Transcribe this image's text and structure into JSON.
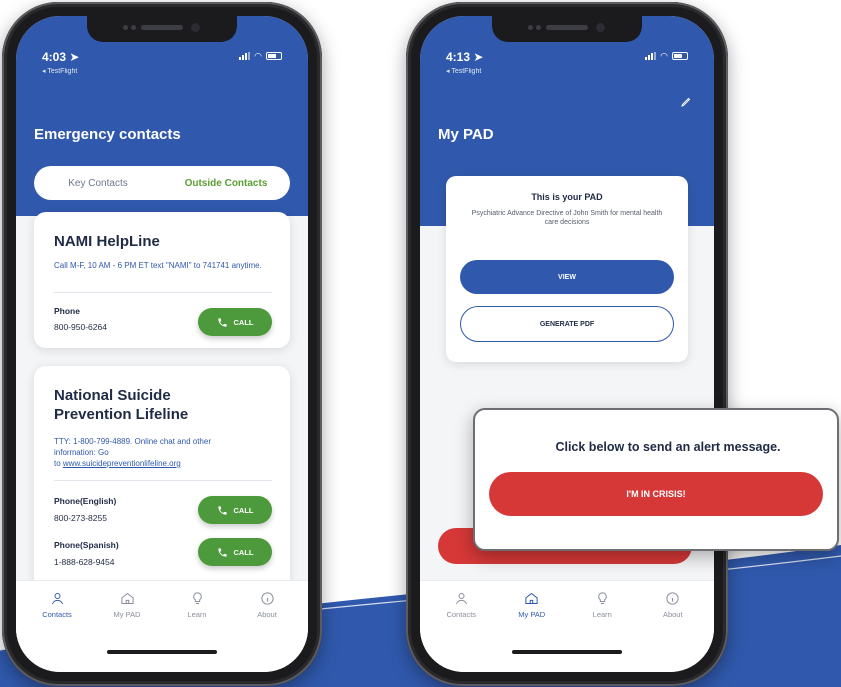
{
  "colors": {
    "brand_blue": "#3059ad",
    "call_green": "#4d9a3c",
    "crisis_red": "#d63837",
    "text_dark": "#1f2a44"
  },
  "phone1": {
    "status": {
      "time": "4:03",
      "source": "◂ TestFlight"
    },
    "title": "Emergency contacts",
    "segments": [
      {
        "label": "Key Contacts",
        "active": false
      },
      {
        "label": "Outside Contacts",
        "active": true
      }
    ],
    "cards": [
      {
        "name": "NAMI HelpLine",
        "description": "Call M-F, 10 AM - 6 PM ET text \"NAMI\" to 741741 anytime.",
        "phones": [
          {
            "label": "Phone",
            "number": "800-950-6264",
            "button": "CALL"
          }
        ]
      },
      {
        "name": "National Suicide Prevention Lifeline",
        "name_line1": "National Suicide",
        "name_line2": "Prevention Lifeline",
        "description_line1": "TTY: 1-800-799-4889. Online chat and other",
        "description_line2": "information: Go",
        "description_line3_prefix": "to",
        "description_link": "www.suicidepreventionlifeline.org",
        "phones": [
          {
            "label": "Phone(English)",
            "number": "800-273-8255",
            "button": "CALL"
          },
          {
            "label": "Phone(Spanish)",
            "number": "1-888-628-9454",
            "button": "CALL"
          }
        ]
      }
    ],
    "tabs": [
      {
        "label": "Contacts",
        "icon": "person-icon",
        "active": true
      },
      {
        "label": "My PAD",
        "icon": "home-icon",
        "active": false
      },
      {
        "label": "Learn",
        "icon": "lightbulb-icon",
        "active": false
      },
      {
        "label": "About",
        "icon": "info-icon",
        "active": false
      }
    ]
  },
  "phone2": {
    "status": {
      "time": "4:13",
      "source": "◂ TestFlight"
    },
    "title": "My PAD",
    "card": {
      "heading": "This is your PAD",
      "subtitle": "Psychiatric Advance Directive of John Smith for mental health care decisions",
      "view_button": "VIEW",
      "generate_button": "GENERATE PDF"
    },
    "tabs": [
      {
        "label": "Contacts",
        "icon": "person-icon",
        "active": false
      },
      {
        "label": "My PAD",
        "icon": "home-icon",
        "active": true
      },
      {
        "label": "Learn",
        "icon": "lightbulb-icon",
        "active": false
      },
      {
        "label": "About",
        "icon": "info-icon",
        "active": false
      }
    ]
  },
  "callout": {
    "text": "Click below to send an alert message.",
    "button": "I'M IN CRISIS!"
  }
}
